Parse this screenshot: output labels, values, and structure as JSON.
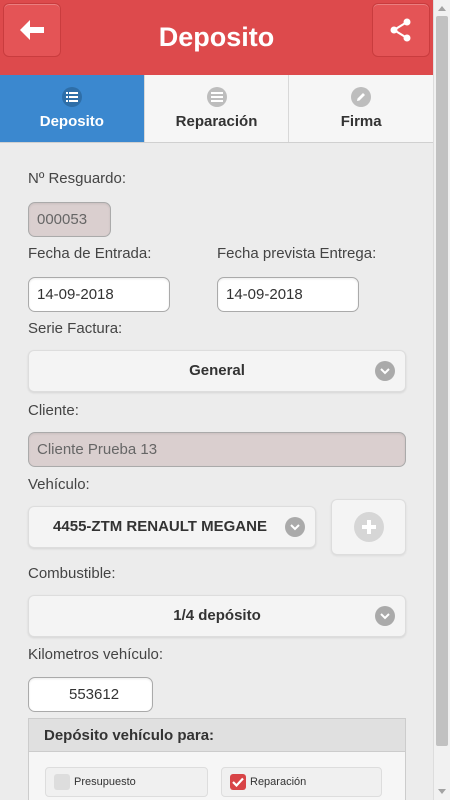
{
  "header": {
    "title": "Deposito",
    "back_icon": "arrow-left-icon",
    "share_icon": "share-icon"
  },
  "tabs": [
    {
      "label": "Deposito",
      "icon": "list-icon",
      "active": true
    },
    {
      "label": "Reparación",
      "icon": "bars-icon",
      "active": false
    },
    {
      "label": "Firma",
      "icon": "pencil-icon",
      "active": false
    }
  ],
  "form": {
    "resguardo_label": "Nº Resguardo:",
    "resguardo_value": "000053",
    "fecha_entrada_label": "Fecha de Entrada:",
    "fecha_entrada_value": "14-09-2018",
    "fecha_entrega_label": "Fecha prevista Entrega:",
    "fecha_entrega_value": "14-09-2018",
    "serie_label": "Serie Factura:",
    "serie_value": "General",
    "cliente_label": "Cliente:",
    "cliente_value": "Cliente Prueba 13",
    "vehiculo_label": "Vehículo:",
    "vehiculo_value": "4455-ZTM RENAULT MEGANE",
    "combustible_label": "Combustible:",
    "combustible_value": "1/4 depósito",
    "km_label": "Kilometros vehículo:",
    "km_value": "553612",
    "deposito_legend": "Depósito vehículo para:",
    "options": [
      {
        "label": "Presupuesto",
        "checked": false
      },
      {
        "label": "Reparación",
        "checked": true
      }
    ]
  },
  "colors": {
    "header": "#dd4a4c",
    "active_tab": "#3b88cf",
    "checkbox_on": "#d84447"
  }
}
